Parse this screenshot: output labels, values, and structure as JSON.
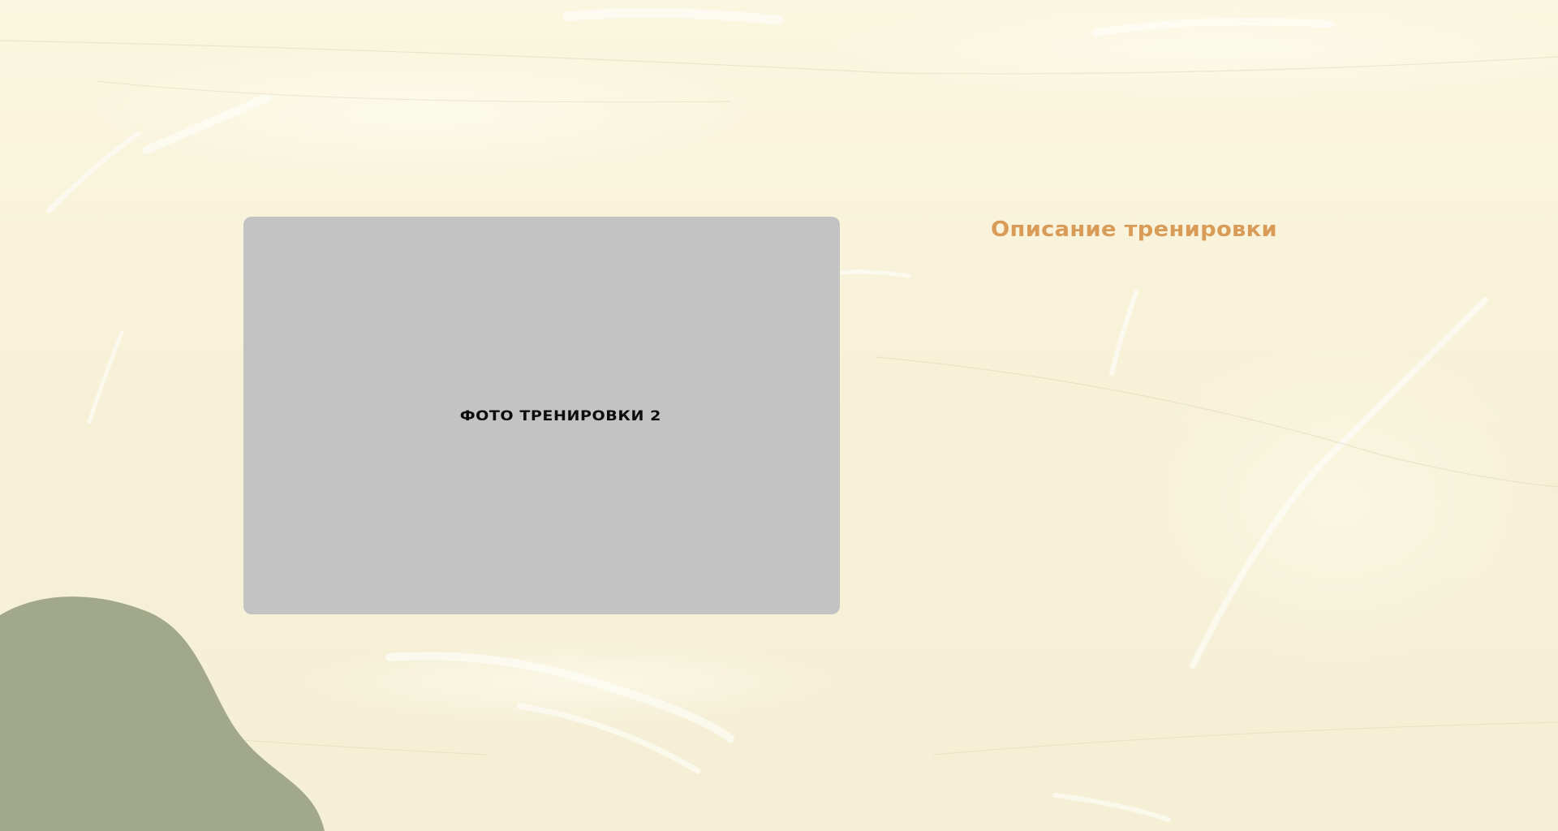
{
  "slide": {
    "photo_placeholder_label": "ФОТО ТРЕНИРОВКИ 2",
    "description_title": "Описание тренировки"
  },
  "colors": {
    "background": "#f9f4dc",
    "placeholder": "#c3c3c4",
    "title_accent": "#d99b58",
    "blob": "#a2a98a"
  }
}
